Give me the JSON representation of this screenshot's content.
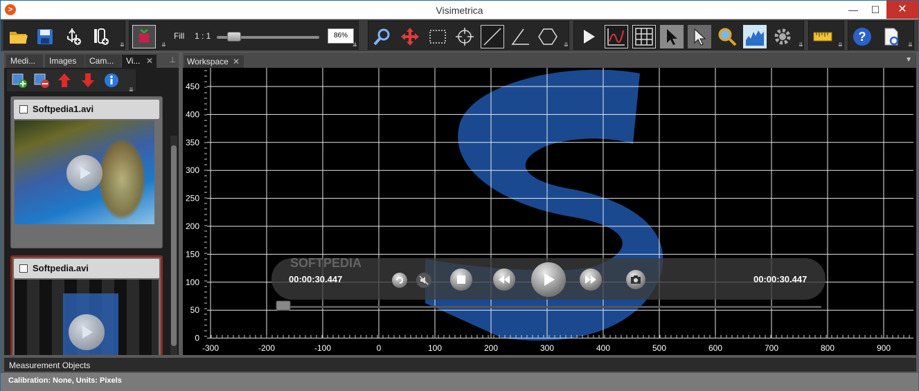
{
  "window": {
    "title": "Visimetrica",
    "minimize": "—",
    "maximize": "☐",
    "close": "✕"
  },
  "toolbar": {
    "fill_label": "Fill",
    "ratio_label": "1 : 1",
    "zoom_percent": "86%",
    "zoom_level": 0.12,
    "buttons": [
      "open-folder-icon",
      "save-icon",
      "usb-icon",
      "add-image-icon",
      "raspberry-pi-icon",
      "zoom-icon",
      "move-icon",
      "rectangle-select-icon",
      "crosshair-icon",
      "line-icon",
      "angle-icon",
      "polygon-icon",
      "play-icon",
      "chart-icon",
      "grid-icon",
      "pointer-icon",
      "pointer-dark-icon",
      "magnifier-icon",
      "histogram-icon",
      "settings-icon",
      "ruler-icon",
      "help-icon",
      "document-icon"
    ]
  },
  "left_panel": {
    "tabs": [
      "Medi...",
      "Images",
      "Cam...",
      "Vi..."
    ],
    "active_tab": "Vi...",
    "videos": [
      {
        "name": "Softpedia1.avi",
        "checked": false,
        "selected": false
      },
      {
        "name": "Softpedia.avi",
        "checked": false,
        "selected": true
      }
    ]
  },
  "workspace": {
    "tab_label": "Workspace",
    "y_ticks": [
      "450",
      "400",
      "350",
      "300",
      "250",
      "200",
      "150",
      "100",
      "50",
      "0"
    ],
    "x_ticks": [
      "-300",
      "-200",
      "-100",
      "0",
      "100",
      "200",
      "300",
      "400",
      "500",
      "600",
      "700",
      "800",
      "900"
    ],
    "player": {
      "time_current": "00:00:30.447",
      "time_total": "00:00:30.447",
      "watermark": "SOFTPEDIA",
      "progress": 0.0
    }
  },
  "bottom": {
    "measurement_label": "Measurement Objects"
  },
  "status": {
    "text": "Calibration: None, Units: Pixels"
  },
  "colors": {
    "accent_blue": "#1f56a8",
    "card_border": "#8b2a22",
    "close_red": "#c7312c"
  }
}
